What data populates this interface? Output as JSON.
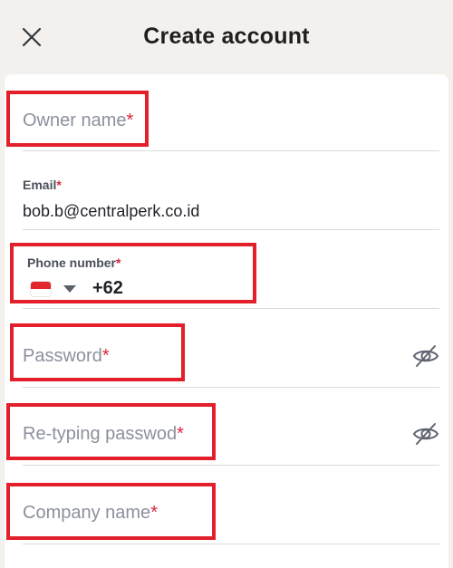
{
  "header": {
    "title": "Create account",
    "close_icon": "close-icon"
  },
  "form": {
    "owner_name": {
      "placeholder": "Owner name",
      "required": "*"
    },
    "email": {
      "label": "Email",
      "required": "*",
      "value": "bob.b@centralperk.co.id"
    },
    "phone": {
      "label": "Phone number",
      "required": "*",
      "country_flag": "indonesia-flag-icon",
      "value": "+62"
    },
    "password": {
      "placeholder": "Password",
      "required": "*",
      "toggle_icon": "eye-off-icon"
    },
    "retype_password": {
      "placeholder": "Re-typing passwod",
      "required": "*",
      "toggle_icon": "eye-off-icon"
    },
    "company_name": {
      "placeholder": "Company name",
      "required": "*"
    }
  },
  "colors": {
    "background": "#f4f0ed",
    "card": "#ffffff",
    "required": "#d7263d",
    "highlight": "#e21f2b",
    "placeholder": "#8b909c"
  }
}
